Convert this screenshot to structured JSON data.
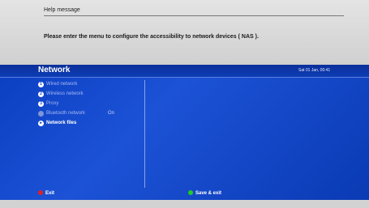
{
  "help": {
    "title": "Help message",
    "body": "Please enter the menu to configure the accessibility to network devices ( NAS )."
  },
  "header": {
    "title": "Network",
    "clock": "Sat 01 Jan, 00:41"
  },
  "menu": {
    "items": [
      {
        "bullet": "1",
        "label": "Wired network"
      },
      {
        "bullet": "2",
        "label": "Wireless network"
      },
      {
        "bullet": "3",
        "label": "Proxy"
      },
      {
        "label": "Bluetooth network",
        "value": "On"
      },
      {
        "label": "Network files"
      }
    ]
  },
  "footer": {
    "exit_label": "Exit",
    "save_label": "Save & exit"
  },
  "colors": {
    "panel_blue": "#0b3fc2",
    "exit_key": "#dd2222",
    "save_key": "#22cc22"
  }
}
